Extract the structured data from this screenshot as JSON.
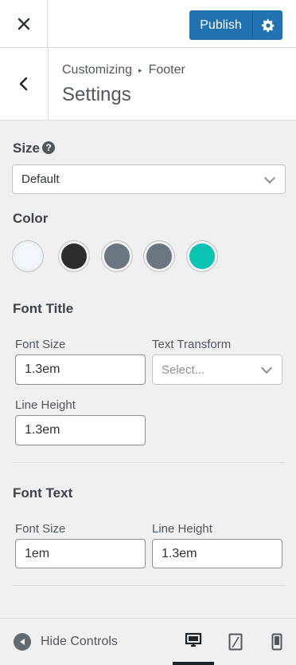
{
  "topbar": {
    "publish_label": "Publish"
  },
  "header": {
    "crumb_root": "Customizing",
    "crumb_section": "Footer",
    "title": "Settings"
  },
  "size": {
    "label": "Size",
    "help": "?",
    "value": "Default"
  },
  "color": {
    "label": "Color",
    "swatches": [
      "#f0f6fc",
      "#2c2c2c",
      "#6b7580",
      "#6b7580",
      "#0cc4b4"
    ]
  },
  "font_title": {
    "heading": "Font Title",
    "font_size_label": "Font Size",
    "font_size_value": "1.3em",
    "text_transform_label": "Text Transform",
    "text_transform_value": "Select...",
    "line_height_label": "Line Height",
    "line_height_value": "1.3em"
  },
  "font_text": {
    "heading": "Font Text",
    "font_size_label": "Font Size",
    "font_size_value": "1em",
    "line_height_label": "Line Height",
    "line_height_value": "1.3em"
  },
  "footer": {
    "hide_controls_label": "Hide Controls",
    "active_device": "desktop"
  }
}
